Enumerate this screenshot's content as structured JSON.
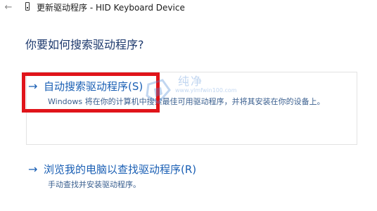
{
  "window": {
    "back_icon": "←",
    "title": "更新驱动程序 - HID Keyboard Device"
  },
  "main": {
    "question": "你要如何搜索驱动程序?",
    "options": [
      {
        "arrow": "→",
        "title": "自动搜索驱动程序(S)",
        "description": "Windows 将在你的计算机中搜索最佳可用驱动程序，并将其安装在你的设备上。"
      },
      {
        "arrow": "→",
        "title": "浏览我的电脑以查找驱动程序(R)",
        "description": "手动查找并安装驱动程序。"
      }
    ]
  },
  "watermark": {
    "text": "纯净",
    "url": "www.ylmfwin100.com"
  },
  "colors": {
    "link": "#1a5fb4",
    "highlight": "#e0141a",
    "watermark": "#4f8bd6"
  }
}
